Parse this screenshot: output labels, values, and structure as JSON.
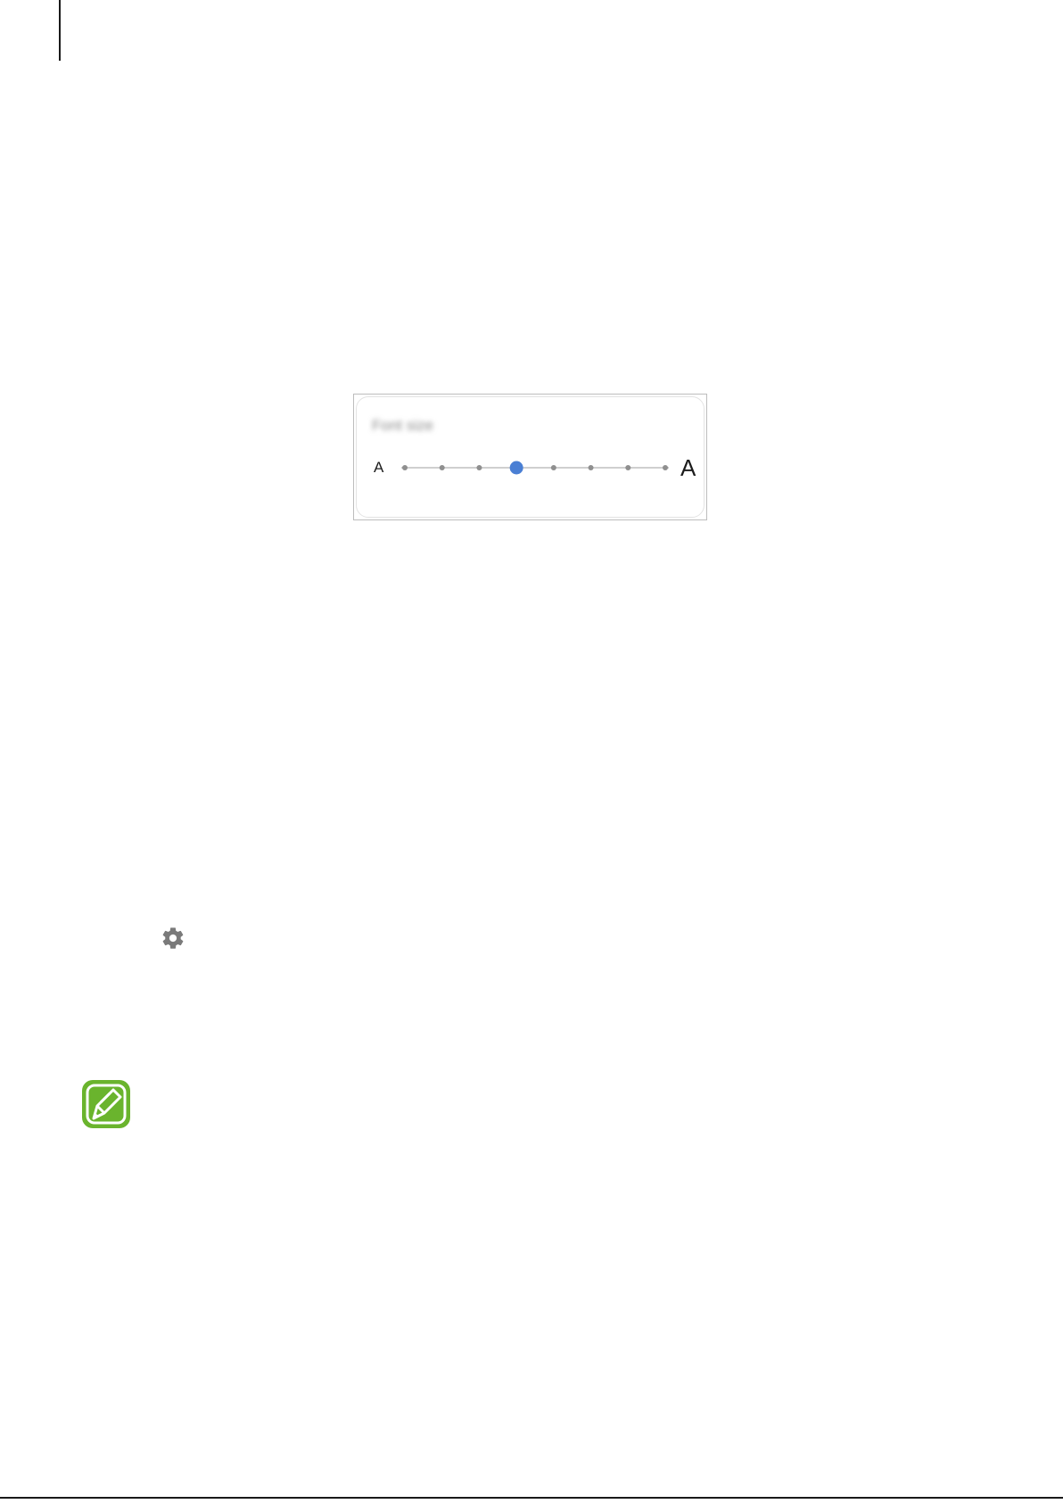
{
  "font_size_panel": {
    "label": "Font size",
    "min_label": "A",
    "max_label": "A",
    "steps": 8,
    "selected_step": 4,
    "accent_color": "#4a7fd4",
    "track_color": "#cfcfcf",
    "dot_color": "#8f8f8f"
  },
  "icons": {
    "settings": "gear-icon",
    "note": "note-pencil-icon",
    "note_color": "#6ab42d"
  }
}
